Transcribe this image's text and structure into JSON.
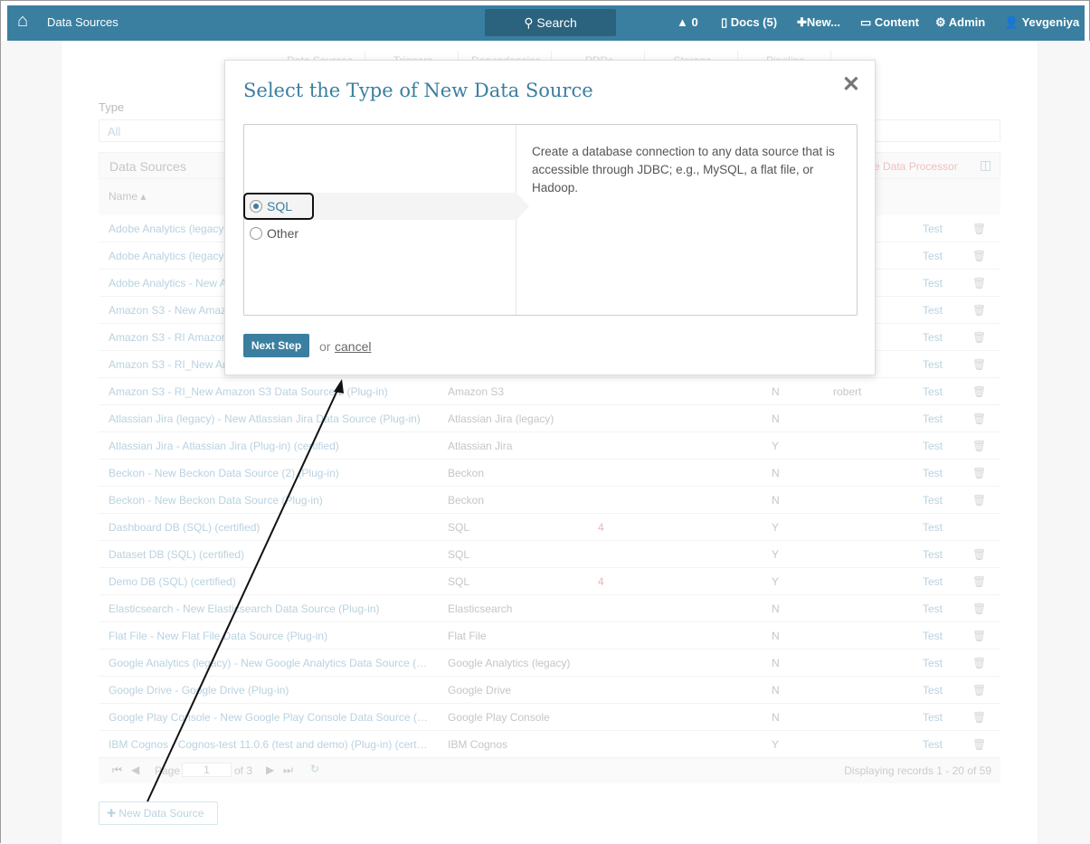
{
  "topbar": {
    "title": "Data Sources",
    "search": "Search",
    "alerts": "0",
    "docs": "Docs (5)",
    "new": "New...",
    "content": "Content",
    "admin": "Admin",
    "user": "Yevgeniya"
  },
  "tabs": [
    "Data Sources",
    "Triggers",
    "Dependencies",
    "PDDs",
    "Storage",
    "Pipeline"
  ],
  "filter": {
    "label": "Type",
    "value": "All"
  },
  "grid": {
    "title": "Data Sources",
    "action": "ve Data Processor",
    "col_name": "Name ▴",
    "rows": [
      [
        "Adobe Analytics (legacy",
        "",
        "",
        "",
        "",
        "Test"
      ],
      [
        "Adobe Analytics (legacy",
        "",
        "",
        "",
        "",
        "Test"
      ],
      [
        "Adobe Analytics - New A",
        "",
        "",
        "",
        "",
        "Test"
      ],
      [
        "Amazon S3 - New Amaz",
        "",
        "",
        "",
        "",
        "Test"
      ],
      [
        "Amazon S3 - RI Amazor",
        "",
        "",
        "",
        "",
        "Test"
      ],
      [
        "Amazon S3 - RI_New Ar",
        "",
        "",
        "",
        "",
        "Test"
      ],
      [
        "Amazon S3 - RI_New Amazon S3 Data Source 2 (Plug-in)",
        "Amazon S3",
        "",
        "N",
        "robert",
        "Test"
      ],
      [
        "Atlassian Jira (legacy) - New Atlassian Jira Data Source (Plug-in)",
        "Atlassian Jira (legacy)",
        "",
        "N",
        "",
        "Test"
      ],
      [
        "Atlassian Jira - Atlassian Jira (Plug-in) (certified)",
        "Atlassian Jira",
        "",
        "Y",
        "",
        "Test"
      ],
      [
        "Beckon - New Beckon Data Source (2) (Plug-in)",
        "Beckon",
        "",
        "N",
        "",
        "Test"
      ],
      [
        "Beckon - New Beckon Data Source (Plug-in)",
        "Beckon",
        "",
        "N",
        "",
        "Test"
      ],
      [
        "Dashboard DB (SQL) (certified)",
        "SQL",
        "4",
        "Y",
        "",
        "Test"
      ],
      [
        "Dataset DB (SQL) (certified)",
        "SQL",
        "",
        "Y",
        "",
        "Test"
      ],
      [
        "Demo DB (SQL) (certified)",
        "SQL",
        "4",
        "Y",
        "",
        "Test"
      ],
      [
        "Elasticsearch - New Elasticsearch Data Source (Plug-in)",
        "Elasticsearch",
        "",
        "N",
        "",
        "Test"
      ],
      [
        "Flat File - New Flat File Data Source (Plug-in)",
        "Flat File",
        "",
        "N",
        "",
        "Test"
      ],
      [
        "Google Analytics (legacy) - New Google Analytics Data Source (…",
        "Google Analytics (legacy)",
        "",
        "N",
        "",
        "Test"
      ],
      [
        "Google Drive - Google Drive (Plug-in)",
        "Google Drive",
        "",
        "N",
        "",
        "Test"
      ],
      [
        "Google Play Console - New Google Play Console Data Source (…",
        "Google Play Console",
        "",
        "N",
        "",
        "Test"
      ],
      [
        "IBM Cognos - Cognos-test 11.0.6 (test and demo) (Plug-in) (cert…",
        "IBM Cognos",
        "",
        "Y",
        "",
        "Test"
      ]
    ],
    "pager": {
      "page_label": "Page",
      "page": "1",
      "of": "of 3",
      "display": "Displaying records 1 - 20 of 59"
    }
  },
  "new_button": "New Data Source",
  "modal": {
    "title": "Select the Type of New Data Source",
    "options": [
      "SQL",
      "Other"
    ],
    "selected": "SQL",
    "description": "Create a database connection to any data source that is accessible through JDBC; e.g., MySQL, a flat file, or Hadoop.",
    "next": "Next Step",
    "or": "or",
    "cancel": "cancel"
  }
}
